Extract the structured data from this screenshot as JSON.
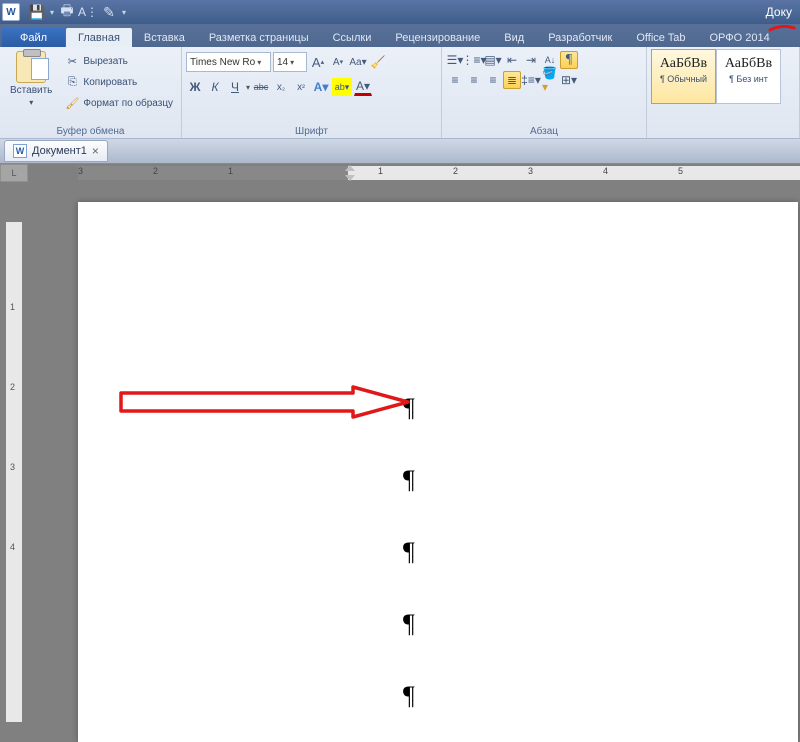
{
  "app": {
    "title_partial": "Доку",
    "document_tab": "Документ1"
  },
  "tabs": {
    "file": "Файл",
    "home": "Главная",
    "insert": "Вставка",
    "layout": "Разметка страницы",
    "references": "Ссылки",
    "review": "Рецензирование",
    "view": "Вид",
    "developer": "Разработчик",
    "office_tab": "Office Tab",
    "orfо": "ОРФО 2014"
  },
  "clipboard": {
    "paste": "Вставить",
    "cut": "Вырезать",
    "copy": "Копировать",
    "format_painter": "Формат по образцу",
    "title": "Буфер обмена"
  },
  "font": {
    "name": "Times New Ro",
    "size": "14",
    "bold": "Ж",
    "italic": "К",
    "underline": "Ч",
    "strike": "abc",
    "sub": "x₂",
    "sup": "x²",
    "grow": "A",
    "shrink": "A",
    "case": "Aa",
    "clear": "⌫",
    "effects": "A",
    "highlight": "ab",
    "color": "A",
    "title": "Шрифт"
  },
  "paragraph": {
    "title": "Абзац"
  },
  "styles": {
    "preview": "АаБбВв",
    "normal": "¶ Обычный",
    "no_spacing": "¶ Без инт"
  },
  "ruler": {
    "h": [
      "3",
      "2",
      "1",
      "",
      "1",
      "2",
      "3",
      "4",
      "5"
    ],
    "v": [
      "",
      "1",
      "2",
      "3",
      "4"
    ]
  },
  "document": {
    "paragraph_marks": [
      "¶",
      "¶",
      "¶",
      "¶",
      "¶"
    ]
  }
}
